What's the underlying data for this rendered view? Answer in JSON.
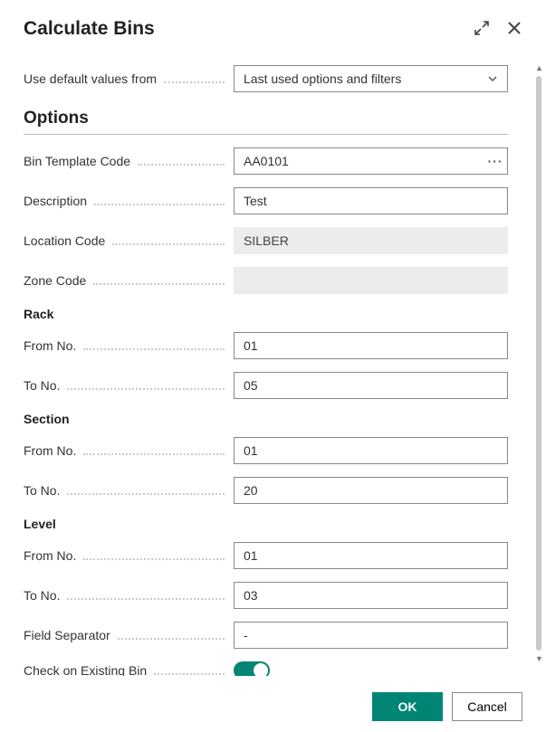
{
  "header": {
    "title": "Calculate Bins"
  },
  "defaults": {
    "label": "Use default values from",
    "value": "Last used options and filters"
  },
  "sections": {
    "options": "Options",
    "rack": "Rack",
    "section": "Section",
    "level": "Level"
  },
  "fields": {
    "binTemplate": {
      "label": "Bin Template Code",
      "value": "AA0101"
    },
    "description": {
      "label": "Description",
      "value": "Test"
    },
    "locationCode": {
      "label": "Location Code",
      "value": "SILBER"
    },
    "zoneCode": {
      "label": "Zone Code",
      "value": ""
    },
    "rackFrom": {
      "label": "From No.",
      "value": "01"
    },
    "rackTo": {
      "label": "To No.",
      "value": "05"
    },
    "sectionFrom": {
      "label": "From No.",
      "value": "01"
    },
    "sectionTo": {
      "label": "To No.",
      "value": "20"
    },
    "levelFrom": {
      "label": "From No.",
      "value": "01"
    },
    "levelTo": {
      "label": "To No.",
      "value": "03"
    },
    "fieldSeparator": {
      "label": "Field Separator",
      "value": "-"
    },
    "checkExisting": {
      "label": "Check on Existing Bin",
      "value": true
    }
  },
  "footer": {
    "ok": "OK",
    "cancel": "Cancel"
  }
}
